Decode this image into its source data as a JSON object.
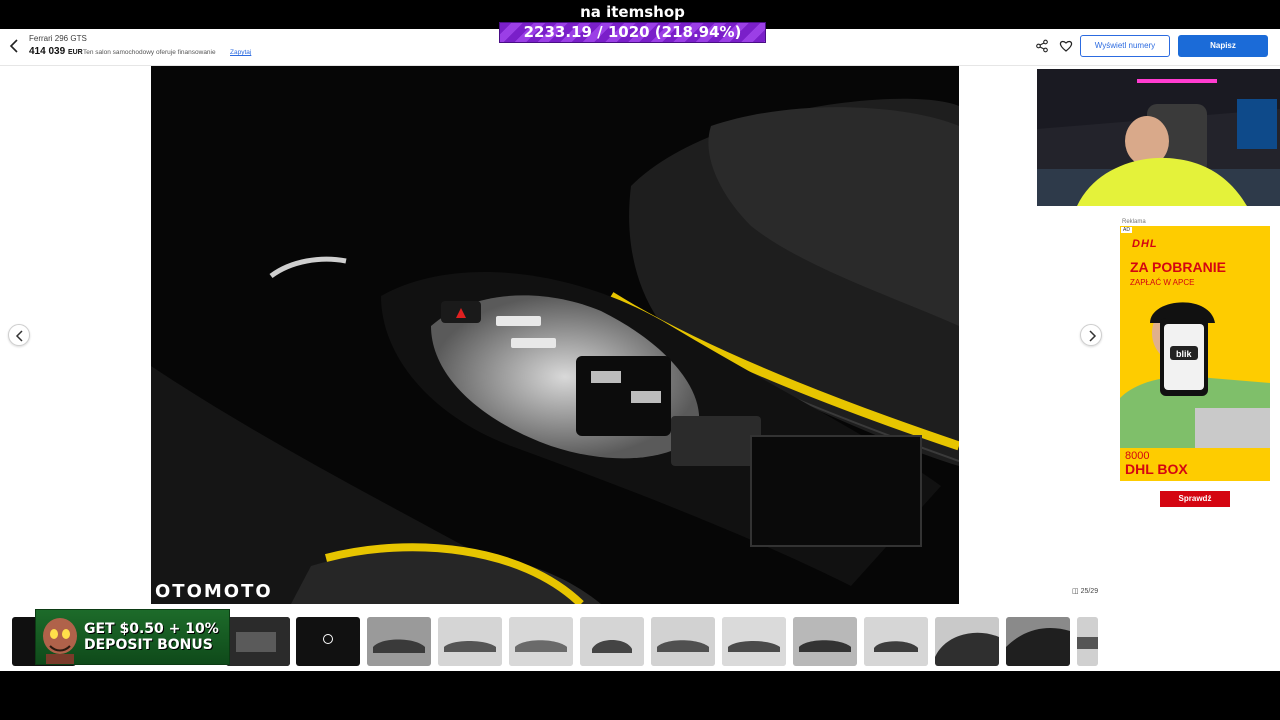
{
  "stream_overlay": {
    "title": "na itemshop",
    "progress_text": "2233.19 / 1020 (218.94%)"
  },
  "header": {
    "title": "Ferrari 296 GTS",
    "price": "414 039",
    "currency": "EUR",
    "financing_note": "Ten salon samochodowy oferuje finansowanie",
    "financing_link": "Zapytaj",
    "show_numbers_button": "Wyświetl numery",
    "write_button": "Napisz"
  },
  "gallery": {
    "watermark": "OTOMOTO",
    "photo_counter": "25/29"
  },
  "ad": {
    "label": "Reklama",
    "badge": "AD",
    "brand": "DHL",
    "headline": "ZA POBRANIE",
    "subline": "ZAPŁAĆ W APCE",
    "phone_text": "blik",
    "amount": "8000",
    "product": "DHL BOX",
    "cta": "Sprawdź"
  },
  "promo": {
    "line1": "GET $0.50 + 10%",
    "line2": "DEPOSIT BONUS"
  },
  "colors": {
    "brand_blue": "#1b6bd8",
    "dhl_yellow": "#fecc00",
    "dhl_red": "#d40511",
    "overlay_purple": "#7a1fc9"
  }
}
